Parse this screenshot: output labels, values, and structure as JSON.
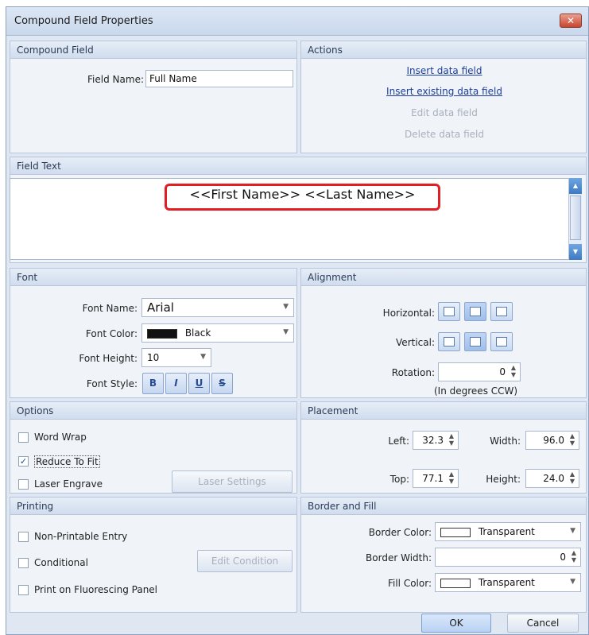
{
  "title": "Compound Field Properties",
  "close_label": "✕",
  "compound_field": {
    "header": "Compound Field",
    "field_name_label": "Field Name:",
    "field_name_value": "Full Name"
  },
  "actions": {
    "header": "Actions",
    "insert_data_field": "Insert data field",
    "insert_existing_data_field": "Insert existing data field",
    "edit_data_field": "Edit data field",
    "delete_data_field": "Delete data field"
  },
  "field_text": {
    "header": "Field Text",
    "value": "<<First Name>> <<Last Name>>"
  },
  "font": {
    "header": "Font",
    "name_label": "Font Name:",
    "name_value": "Arial",
    "color_label": "Font Color:",
    "color_value": "Black",
    "color_swatch": "#111111",
    "height_label": "Font Height:",
    "height_value": "10",
    "style_label": "Font Style:",
    "style_bold": "B",
    "style_italic": "I",
    "style_underline": "U",
    "style_strike": "S"
  },
  "alignment": {
    "header": "Alignment",
    "horizontal_label": "Horizontal:",
    "vertical_label": "Vertical:",
    "rotation_label": "Rotation:",
    "rotation_value": "0",
    "rotation_note": "(In degrees CCW)"
  },
  "options": {
    "header": "Options",
    "word_wrap": "Word Wrap",
    "reduce_to_fit": "Reduce To Fit",
    "laser_engrave": "Laser Engrave",
    "laser_settings": "Laser Settings"
  },
  "placement": {
    "header": "Placement",
    "left_label": "Left:",
    "left_value": "32.3",
    "width_label": "Width:",
    "width_value": "96.0",
    "top_label": "Top:",
    "top_value": "77.1",
    "height_label": "Height:",
    "height_value": "24.0"
  },
  "printing": {
    "header": "Printing",
    "non_printable": "Non-Printable Entry",
    "conditional": "Conditional",
    "edit_condition": "Edit Condition",
    "fluorescing": "Print on Fluorescing Panel"
  },
  "border_fill": {
    "header": "Border and Fill",
    "border_color_label": "Border Color:",
    "border_color_value": "Transparent",
    "border_width_label": "Border Width:",
    "border_width_value": "0",
    "fill_color_label": "Fill Color:",
    "fill_color_value": "Transparent"
  },
  "buttons": {
    "ok": "OK",
    "cancel": "Cancel"
  },
  "icons": {
    "spin_up": "▲",
    "spin_down": "▼",
    "dropdown": "▼",
    "check": "✓"
  }
}
